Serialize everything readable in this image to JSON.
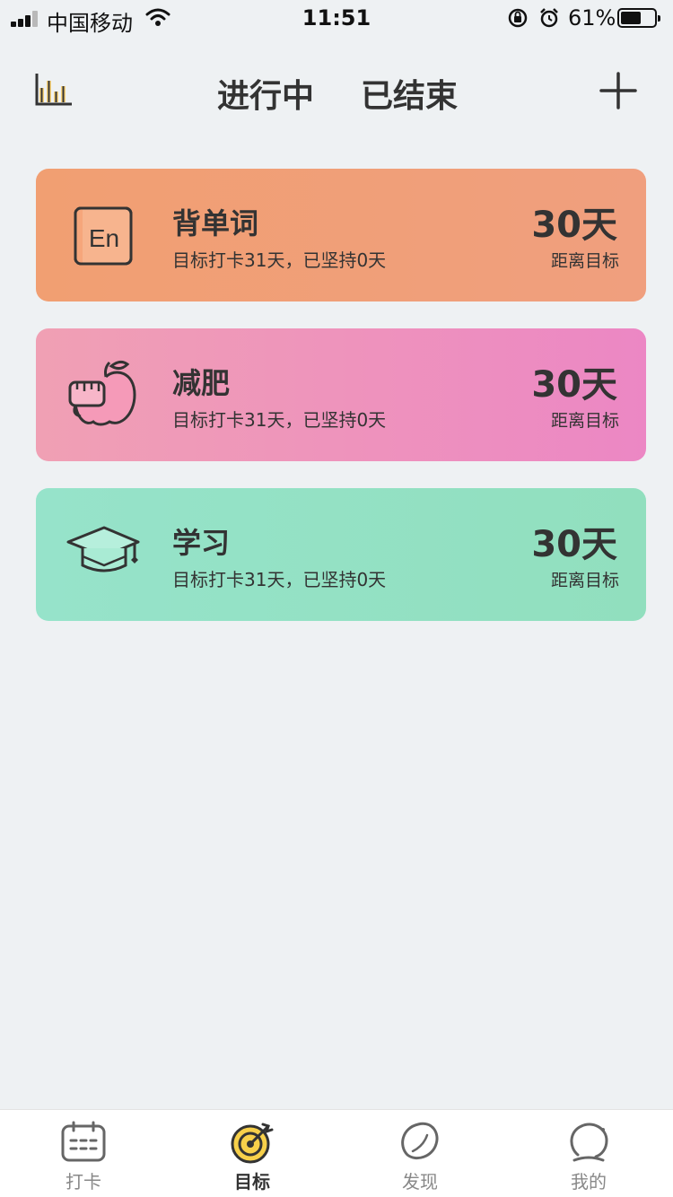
{
  "status_bar": {
    "carrier": "中国移动",
    "time": "11:51",
    "battery": "61%",
    "battery_level": 0.61
  },
  "header": {
    "tabs": [
      {
        "label": "进行中",
        "active": true
      },
      {
        "label": "已结束",
        "active": false
      }
    ],
    "icons": {
      "left": "bar-chart-icon",
      "right": "plus-icon"
    }
  },
  "goals": [
    {
      "title": "背单词",
      "subtitle": "目标打卡31天，已坚持0天",
      "days": "30天",
      "caption": "距离目标",
      "icon": "english-en-icon",
      "color_from": "#f19f72",
      "color_to": "#f09f7e"
    },
    {
      "title": "减肥",
      "subtitle": "目标打卡31天，已坚持0天",
      "days": "30天",
      "caption": "距离目标",
      "icon": "apple-scale-icon",
      "color_from": "#f0a0b4",
      "color_to": "#ec87c4"
    },
    {
      "title": "学习",
      "subtitle": "目标打卡31天，已坚持0天",
      "days": "30天",
      "caption": "距离目标",
      "icon": "graduation-cap-icon",
      "color_from": "#96e3ca",
      "color_to": "#91dfbe"
    }
  ],
  "tab_bar": [
    {
      "label": "打卡",
      "icon": "calendar-icon",
      "active": false
    },
    {
      "label": "目标",
      "icon": "target-icon",
      "active": true
    },
    {
      "label": "发现",
      "icon": "planet-icon",
      "active": false
    },
    {
      "label": "我的",
      "icon": "profile-icon",
      "active": false
    }
  ],
  "colors": {
    "background": "#eef1f3",
    "accent": "#f7d27a",
    "text": "#333333"
  }
}
